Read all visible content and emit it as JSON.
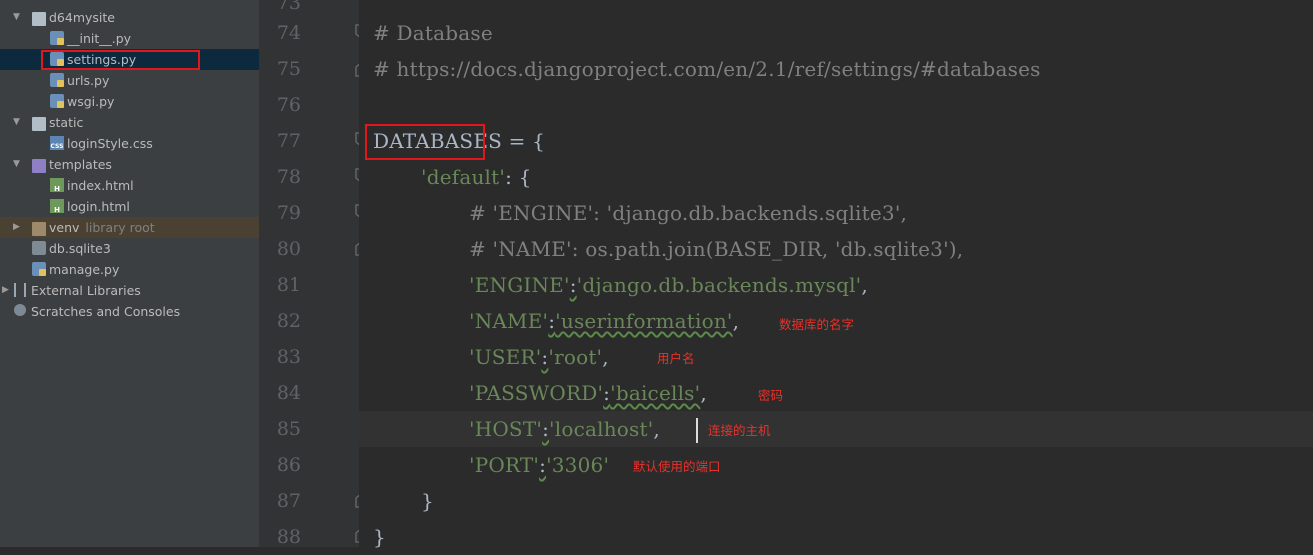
{
  "project_tree": {
    "items": [
      {
        "label": "d64mysite",
        "kind": "folder"
      },
      {
        "label": "__init__.py",
        "kind": "py"
      },
      {
        "label": "settings.py",
        "kind": "py"
      },
      {
        "label": "urls.py",
        "kind": "py"
      },
      {
        "label": "wsgi.py",
        "kind": "py"
      },
      {
        "label": "static",
        "kind": "folder"
      },
      {
        "label": "loginStyle.css",
        "kind": "css"
      },
      {
        "label": "templates",
        "kind": "folder"
      },
      {
        "label": "index.html",
        "kind": "html"
      },
      {
        "label": "login.html",
        "kind": "html"
      },
      {
        "label": "venv",
        "sublabel": "library root",
        "kind": "folder"
      },
      {
        "label": "db.sqlite3",
        "kind": "db"
      },
      {
        "label": "manage.py",
        "kind": "py"
      },
      {
        "label": "External Libraries",
        "kind": "libs"
      },
      {
        "label": "Scratches and Consoles",
        "kind": "scratch"
      }
    ]
  },
  "editor": {
    "line_numbers": [
      "73",
      "74",
      "75",
      "76",
      "77",
      "78",
      "79",
      "80",
      "81",
      "82",
      "83",
      "84",
      "85",
      "86",
      "87",
      "88"
    ],
    "lines": {
      "l74": "# Database",
      "l75": "# https://docs.djangoproject.com/en/2.1/ref/settings/#databases",
      "l77_var": "DATABASES",
      "l77_rest": " = {",
      "l78_key": "'default'",
      "l78_rest": ": {",
      "l79": "# 'ENGINE': 'django.db.backends.sqlite3',",
      "l80": "# 'NAME': os.path.join(BASE_DIR, 'db.sqlite3'),",
      "l81_key": "'ENGINE'",
      "l81_val": "'django.db.backends.mysql'",
      "l82_key": "'NAME'",
      "l82_val": "'userinformation'",
      "l83_key": "'USER'",
      "l83_val": "'root'",
      "l84_key": "'PASSWORD'",
      "l84_val": "'baicells'",
      "l85_key": "'HOST'",
      "l85_val": "'localhost'",
      "l86_key": "'PORT'",
      "l86_val": "'3306'",
      "l87": "}",
      "l88": "}",
      "colon": ":",
      "comma": ","
    },
    "annotations": {
      "name": "数据库的名字",
      "user": "用户名",
      "password": "密码",
      "host": "连接的主机",
      "port": "默认使用的端口"
    }
  },
  "colors": {
    "comment": "#808080",
    "string": "#6a8759",
    "plain": "#a9b7c6",
    "annotation": "#e8322b",
    "highlight_box": "#e0181b"
  }
}
